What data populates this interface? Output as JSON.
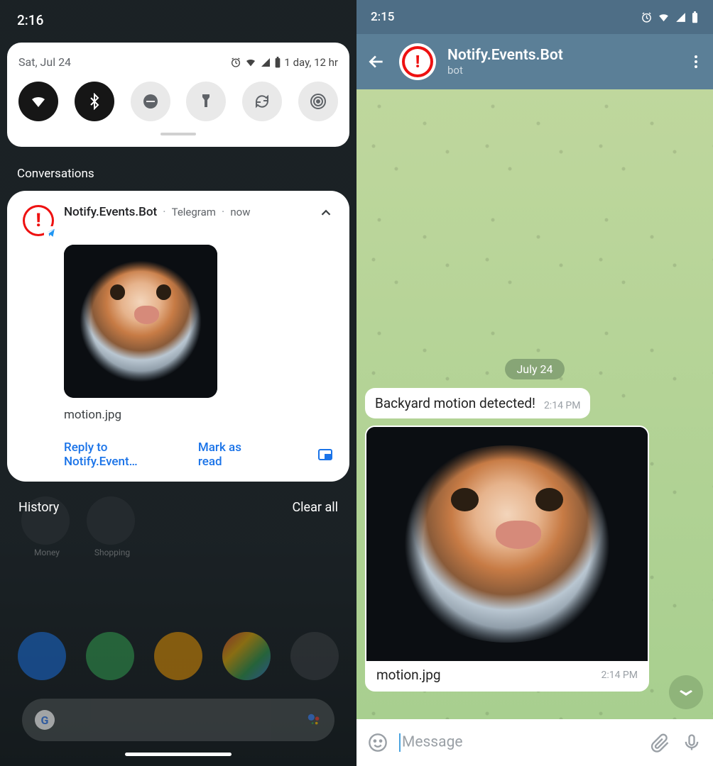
{
  "left": {
    "status_time": "2:16",
    "qs": {
      "date": "Sat, Jul 24",
      "battery_text": "1 day, 12 hr",
      "toggles": [
        {
          "name": "wifi",
          "active": true
        },
        {
          "name": "bluetooth",
          "active": true
        },
        {
          "name": "dnd",
          "active": false
        },
        {
          "name": "flashlight",
          "active": false
        },
        {
          "name": "autorotate",
          "active": false
        },
        {
          "name": "cast",
          "active": false
        }
      ]
    },
    "sections": {
      "conversations": "Conversations",
      "history": "History",
      "clear_all": "Clear all"
    },
    "notification": {
      "sender": "Notify.Events.Bot",
      "app": "Telegram",
      "time": "now",
      "filename": "motion.jpg",
      "action_reply": "Reply to Notify.Event…",
      "action_mark": "Mark as read"
    },
    "folders": [
      {
        "label": "Money"
      },
      {
        "label": "Shopping"
      }
    ]
  },
  "right": {
    "status_time": "2:15",
    "chat": {
      "title": "Notify.Events.Bot",
      "subtitle": "bot",
      "date_chip": "July 24",
      "msg_text": "Backyard motion detected!",
      "msg_time": "2:14 PM",
      "img_caption": "motion.jpg",
      "img_time": "2:14 PM",
      "input_placeholder": "Message"
    }
  }
}
